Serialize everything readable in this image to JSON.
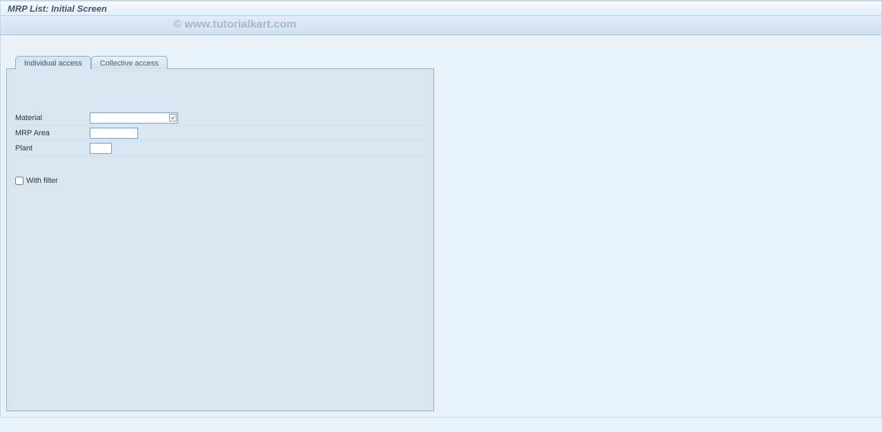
{
  "header": {
    "title": "MRP List: Initial Screen"
  },
  "watermark": "© www.tutorialkart.com",
  "tabs": {
    "individual": "Individual access",
    "collective": "Collective access"
  },
  "form": {
    "material_label": "Material",
    "material_value": "",
    "mrparea_label": "MRP Area",
    "mrparea_value": "",
    "plant_label": "Plant",
    "plant_value": "",
    "withfilter_label": "With filter"
  }
}
